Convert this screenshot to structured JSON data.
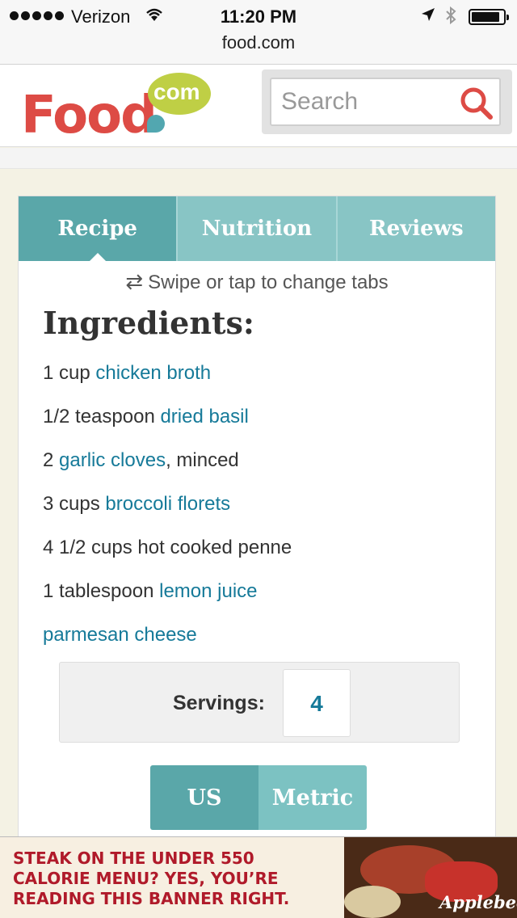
{
  "status_bar": {
    "carrier": "Verizon",
    "time": "11:20 PM",
    "url": "food.com",
    "battery_level": 0.9
  },
  "header": {
    "logo_text": "Food",
    "logo_com": "com",
    "search_placeholder": "Search"
  },
  "tabs": [
    {
      "label": "Recipe",
      "active": true
    },
    {
      "label": "Nutrition",
      "active": false
    },
    {
      "label": "Reviews",
      "active": false
    }
  ],
  "swipe_hint": "Swipe or tap to change tabs",
  "ingredients_heading": "Ingredients:",
  "ingredients": [
    {
      "pre": "1 cup ",
      "link": "chicken broth",
      "post": ""
    },
    {
      "pre": "1/2 teaspoon ",
      "link": "dried basil",
      "post": ""
    },
    {
      "pre": "2 ",
      "link": "garlic cloves",
      "post": ", minced"
    },
    {
      "pre": "3 cups ",
      "link": "broccoli florets",
      "post": ""
    },
    {
      "pre": "4 1/2 cups hot cooked penne",
      "link": "",
      "post": ""
    },
    {
      "pre": "1 tablespoon ",
      "link": "lemon juice",
      "post": ""
    },
    {
      "pre": "",
      "link": "parmesan cheese",
      "post": ""
    }
  ],
  "servings": {
    "label": "Servings:",
    "value": "4"
  },
  "units": [
    {
      "label": "US",
      "active": true
    },
    {
      "label": "Metric",
      "active": false
    }
  ],
  "ad": {
    "line1": "STEAK ON THE UNDER 550",
    "line2": "CALORIE MENU? YES, YOU’RE",
    "line3": "READING THIS BANNER RIGHT.",
    "brand": "Applebees"
  },
  "colors": {
    "tab_active": "#5aa7a9",
    "tab_inactive": "#88c5c5",
    "link": "#167a99",
    "logo_red": "#dd4b45",
    "logo_green": "#bfcf45",
    "ad_red": "#b01a2a"
  }
}
